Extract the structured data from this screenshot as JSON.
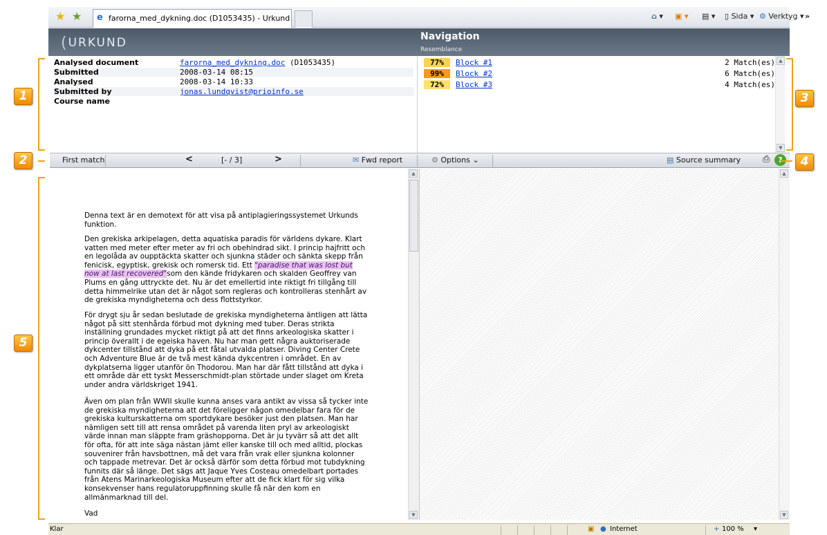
{
  "browser": {
    "tab_title": "farorna_med_dykning.doc (D1053435) - Urkund",
    "menu_page": "Sida",
    "menu_tools": "Verktyg",
    "chevron": "»"
  },
  "header": {
    "logo": "URKUND",
    "nav_title": "Navigation",
    "nav_subtitle": "Resemblance"
  },
  "info": {
    "rows": [
      {
        "label": "Analysed document",
        "value": "farorna_med_dykning.doc",
        "extra": " (D1053435)"
      },
      {
        "label": "Submitted",
        "value": "2008-03-14 08:15"
      },
      {
        "label": "Analysed",
        "value": "2008-03-14 10:33"
      },
      {
        "label": "Submitted by",
        "value": "jonas.lundqvist@prioinfo.se"
      },
      {
        "label": "Course name",
        "value": ""
      }
    ]
  },
  "matches": [
    {
      "percent": "77%",
      "block": "Block #1",
      "count": "2 Match(es)",
      "color": "#ffd24d"
    },
    {
      "percent": "99%",
      "block": "Block #2",
      "count": "6 Match(es)",
      "color": "#f49a1d"
    },
    {
      "percent": "72%",
      "block": "Block #3",
      "count": "4 Match(es)",
      "color": "#ffe06a"
    }
  ],
  "toolbar": {
    "first_match": "First match",
    "prev": "<",
    "position": "[- / 3]",
    "next": ">",
    "fwd_report": "Fwd report",
    "options": "Options",
    "source_summary": "Source summary"
  },
  "document": {
    "p1": "Denna text är en demotext för att visa på antiplagieringssystemet Urkunds funktion.",
    "p2_before": "Den grekiska arkipelagen, detta aquatiska paradis för världens dykare. Klart vatten med meter efter meter av fri och obehindrad sikt. I princip hajfritt och en legolåda av oupptäckta skatter och sjunkna städer och sänkta skepp från fenicisk, egyptisk, grekisk och romersk tid. Ett ",
    "p2_highlight": "\"paradise that was lost but now at last recovered\"",
    "p2_after": "som den kände fridykaren och skalden Geoffrey van Plums en gång uttryckte det. Nu är det emellertid inte riktigt fri tillgång till detta himmelrike utan det är något som regleras och kontrolleras stenhårt av de grekiska myndigheterna och dess flottstyrkor.",
    "p3": "För drygt sju år sedan beslutade de grekiska myndigheterna äntligen att lätta något på sitt stenhårda förbud mot dykning med tuber. Deras strikta inställning grundades mycket riktigt på att det finns arkeologiska skatter i princip överallt i de egeiska haven. Nu har man gett några auktoriserade dykcenter tillstånd att dyka på ett fåtal utvalda platser. Diving Center Crete och Adventure Blue är de två mest kända dykcentren i området. En av dykplatserna ligger utanför ön Thodorou. Man har där fått tillstånd att dyka i ett område där ett tyskt Messerschmidt-plan störtade under slaget om Kreta under andra världskriget 1941.",
    "p4": "Även om plan från WWII skulle kunna anses vara antikt av vissa så tycker inte de grekiska myndigheterna att det föreligger någon omedelbar fara för de grekiska kulturskatterna om sportdykare besöker just den platsen. Man har nämligen sett till att rensa området på varenda liten pryl av arkeologiskt värde innan man släppte fram gräshopporna. Det är ju tyvärr så att det allt för ofta, för att inte säga nästan jämt eller kanske till och med alltid, plockas souvenirer från havsbottnen, må det vara från vrak eller sjunkna kolonner och tappade metrevar. Det är också därför som detta förbud mot tubdykning funnits där så länge. Det sägs att Jaque Yves Costeau omedelbart portades från Atens Marinarkeologiska Museum efter att de fick klart för sig vilka konsekvenser hans regulatoruppfinning skulle få när den kom en allmänmarknad till del.",
    "p5": "Vad"
  },
  "status": {
    "left": "Klar",
    "zone": "Internet",
    "zoom": "100 %"
  },
  "callouts": [
    "1",
    "2",
    "3",
    "4",
    "5"
  ]
}
